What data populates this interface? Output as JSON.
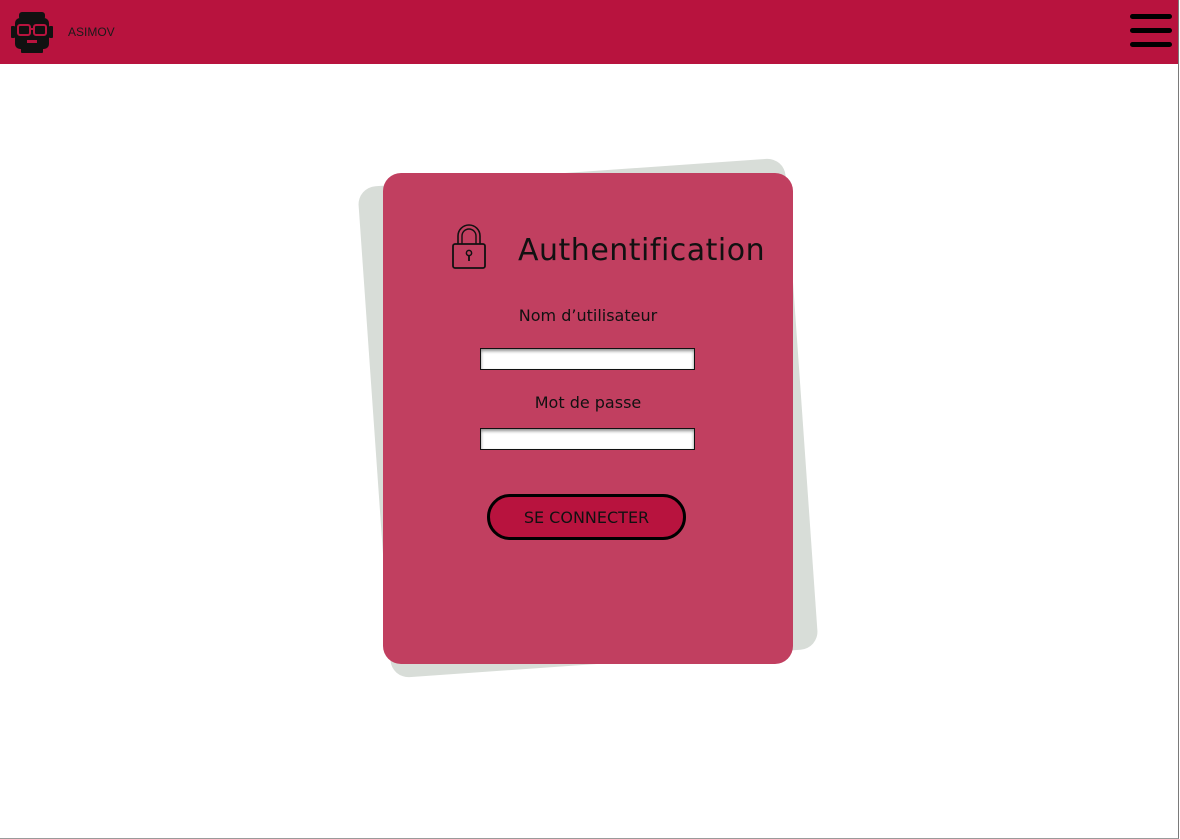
{
  "header": {
    "brand": "ASIMOV",
    "background_color": "#b8133e",
    "logo_icon": "robot-head-with-glasses-icon",
    "menu_icon": "hamburger-menu-icon"
  },
  "login": {
    "title": "Authentification",
    "lock_icon": "padlock-icon",
    "username_label": "Nom d’utilisateur",
    "username_value": "",
    "password_label": "Mot de passe",
    "password_value": "",
    "submit_label": "SE CONNECTER",
    "card_color": "#c13f60",
    "card_shadow_color": "#d8ddd8"
  }
}
